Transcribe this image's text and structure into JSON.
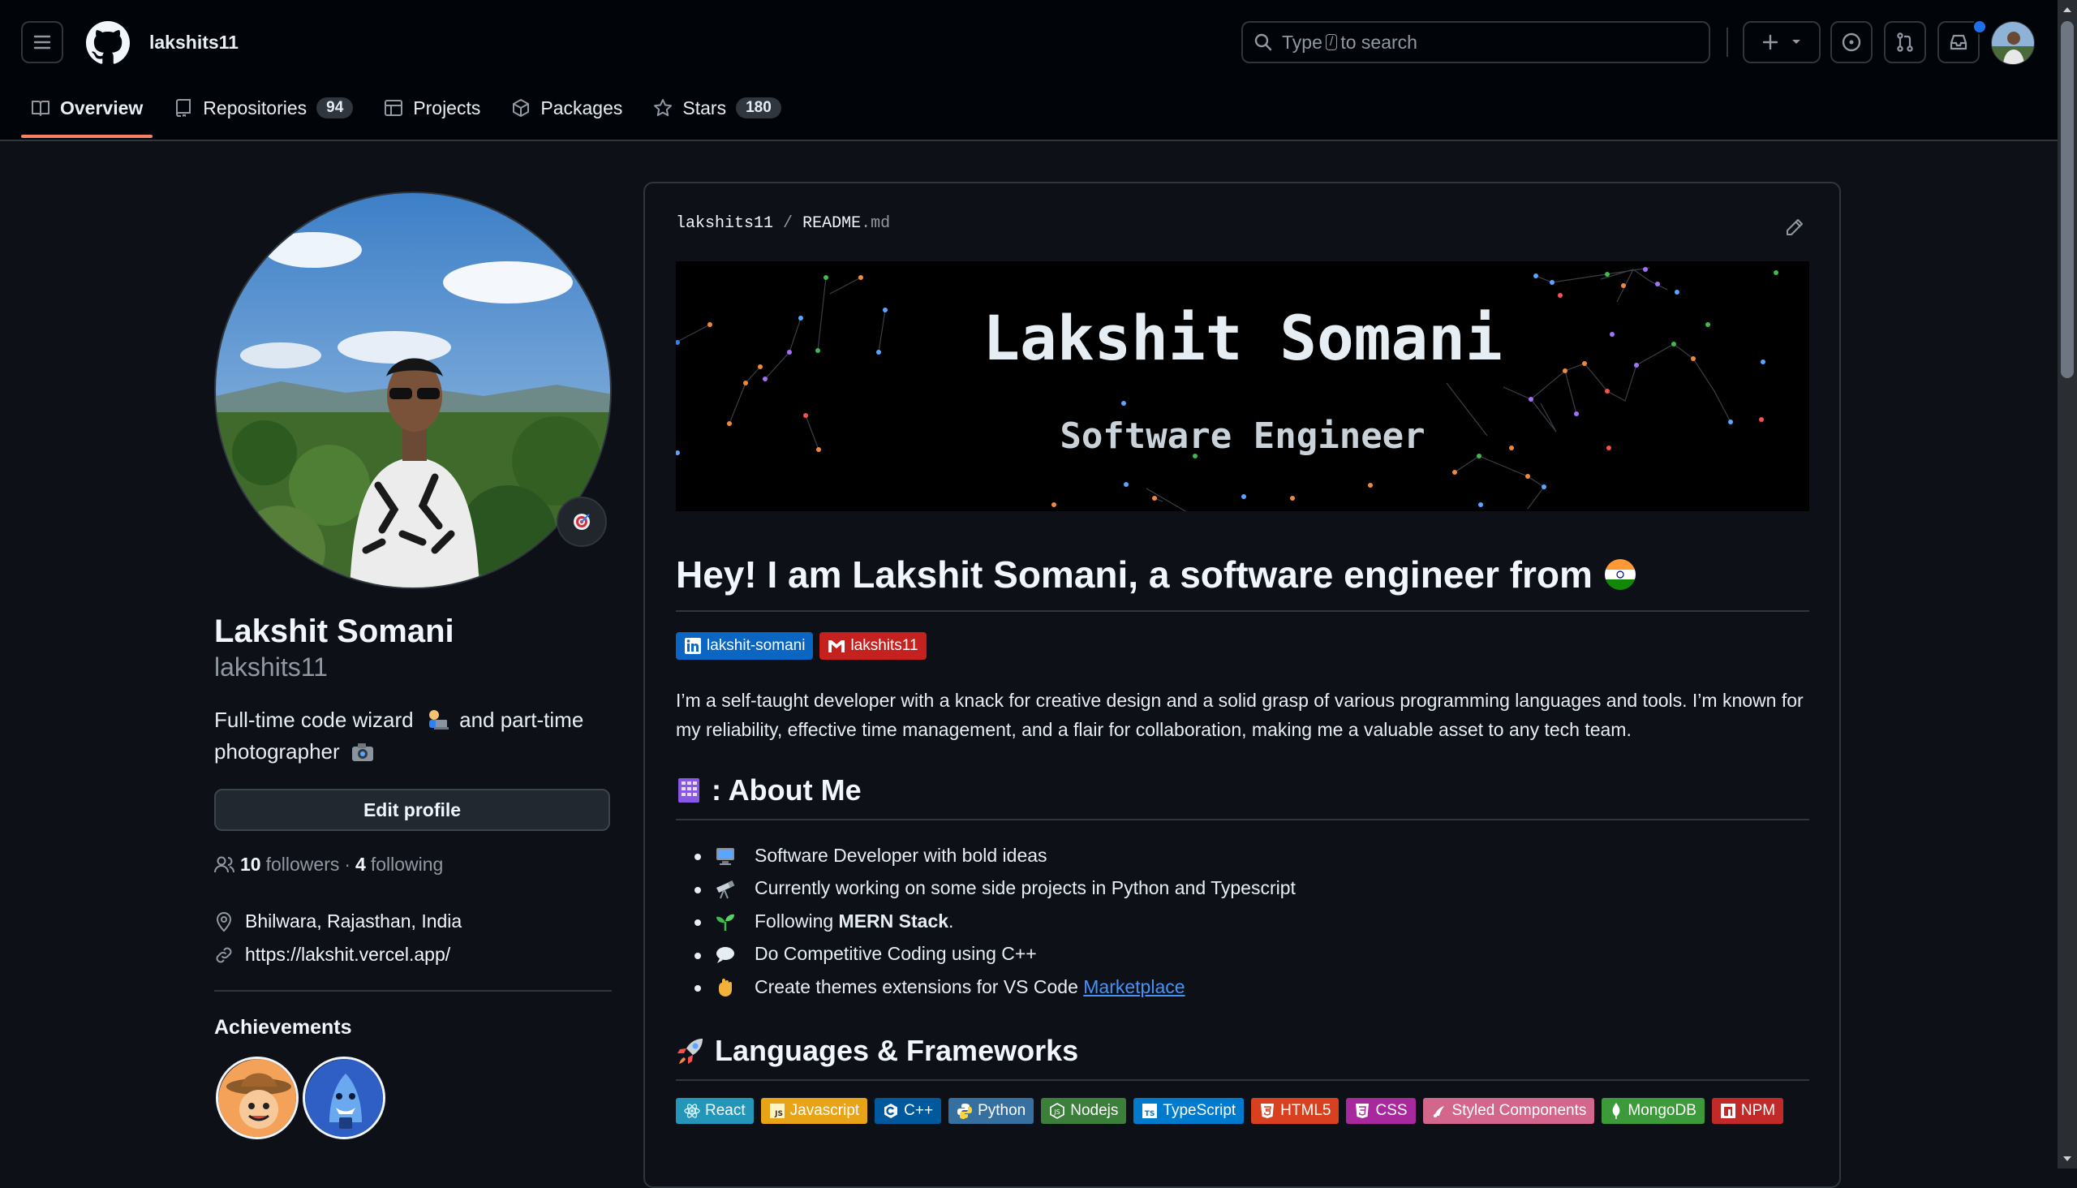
{
  "header": {
    "owner": "lakshits11",
    "search_pre": "Type",
    "search_key": "/",
    "search_post": "to search",
    "tabs": [
      {
        "label": "Overview",
        "count": null
      },
      {
        "label": "Repositories",
        "count": "94"
      },
      {
        "label": "Projects",
        "count": null
      },
      {
        "label": "Packages",
        "count": null
      },
      {
        "label": "Stars",
        "count": "180"
      }
    ]
  },
  "profile": {
    "name": "Lakshit Somani",
    "login": "lakshits11",
    "bio_line1": "Full-time code wizard",
    "bio_mid": "and part-time",
    "bio_line2": "photographer",
    "edit_label": "Edit profile",
    "followers_count": "10",
    "followers_label": "followers",
    "sep": "·",
    "following_count": "4",
    "following_label": "following",
    "location": "Bhilwara, Rajasthan, India",
    "website": "https://lakshit.vercel.app/",
    "achievements_title": "Achievements"
  },
  "readme": {
    "path_owner": "lakshits11",
    "path_sep": "/",
    "file_name": "README",
    "file_ext": ".md",
    "banner_title": "Lakshit Somani",
    "banner_subtitle": "Software Engineer",
    "heading": "Hey! I am Lakshit Somani, a software engineer from",
    "social_badges": [
      {
        "label": "lakshit-somani",
        "color": "#0a66c2",
        "icon": "linkedin-icon"
      },
      {
        "label": "lakshits11",
        "color": "#c5221f",
        "icon": "gmail-icon"
      }
    ],
    "intro": "I’m a self-taught developer with a knack for creative design and a solid grasp of various programming languages and tools. I’m known for my reliability, effective time management, and a flair for collaboration, making me a valuable asset to any tech team.",
    "about_heading": ": About Me",
    "about_items": [
      {
        "pre": "Software Developer with bold ideas",
        "bold": "",
        "post": "",
        "link": ""
      },
      {
        "pre": "Currently working on some side projects in Python and Typescript",
        "bold": "",
        "post": "",
        "link": ""
      },
      {
        "pre": "Following ",
        "bold": "MERN Stack",
        "post": ".",
        "link": ""
      },
      {
        "pre": "Do Competitive Coding using C++",
        "bold": "",
        "post": "",
        "link": ""
      },
      {
        "pre": "Create themes extensions for VS Code ",
        "bold": "",
        "post": "",
        "link": "Marketplace"
      }
    ],
    "lang_heading": "Languages & Frameworks",
    "tech_badges": [
      {
        "label": "React",
        "color": "#20232a",
        "bg": "#2496b9"
      },
      {
        "label": "Javascript",
        "color": "#f7df1e",
        "bg": "#e8a317"
      },
      {
        "label": "C++",
        "color": "#00599c",
        "bg": "#00599c"
      },
      {
        "label": "Python",
        "color": "#3670a0",
        "bg": "#3670a0"
      },
      {
        "label": "Nodejs",
        "color": "#43853d",
        "bg": "#3c7f3a"
      },
      {
        "label": "TypeScript",
        "color": "#007acc",
        "bg": "#007acc"
      },
      {
        "label": "HTML5",
        "color": "#e34f26",
        "bg": "#d9401f"
      },
      {
        "label": "CSS",
        "color": "#c02eb0",
        "bg": "#a8289d"
      },
      {
        "label": "Styled Components",
        "color": "#db7093",
        "bg": "#d2668b"
      },
      {
        "label": "MongoDB",
        "color": "#4ea94b",
        "bg": "#3d9a3b"
      },
      {
        "label": "NPM",
        "color": "#cb3837",
        "bg": "#c12a29"
      }
    ]
  }
}
